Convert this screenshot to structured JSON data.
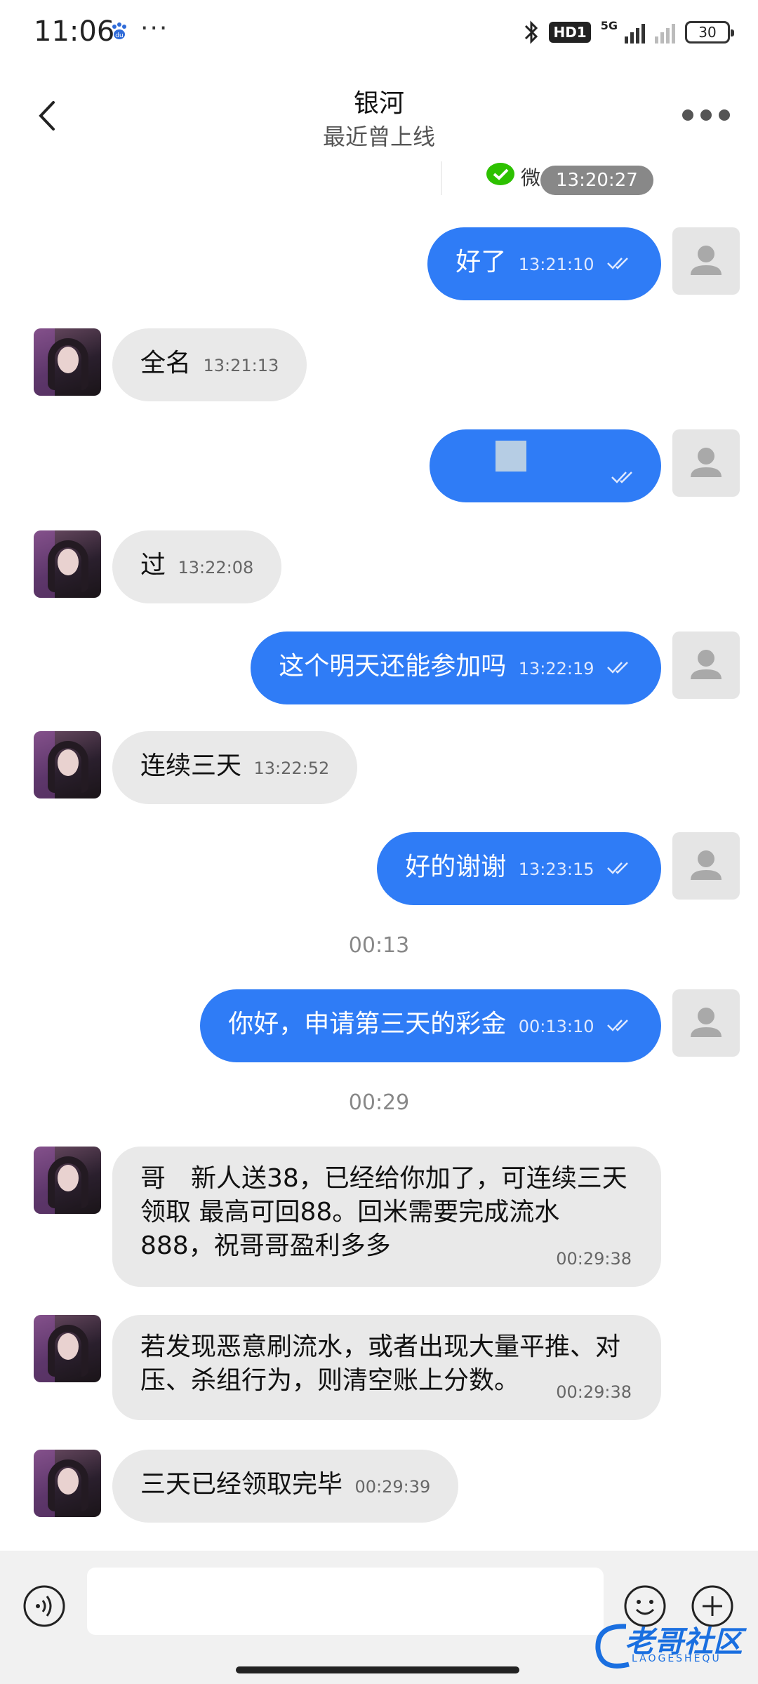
{
  "status_bar": {
    "time": "11:06",
    "more": "···",
    "hd": "HD1",
    "network": "5G",
    "battery": "30"
  },
  "header": {
    "title": "银河",
    "subtitle": "最近曾上线"
  },
  "partial_message": {
    "preview": "微",
    "time": "13:20:27"
  },
  "messages": [
    {
      "dir": "out",
      "text": "好了",
      "time": "13:21:10"
    },
    {
      "dir": "in",
      "text": "全名",
      "time": "13:21:13"
    },
    {
      "dir": "out",
      "text": "",
      "time": "",
      "redacted": true
    },
    {
      "dir": "in",
      "text": "过",
      "time": "13:22:08"
    },
    {
      "dir": "out",
      "text": "这个明天还能参加吗",
      "time": "13:22:19"
    },
    {
      "dir": "in",
      "text": "连续三天",
      "time": "13:22:52"
    },
    {
      "dir": "out",
      "text": "好的谢谢",
      "time": "13:23:15"
    },
    {
      "dir": "out",
      "text": "你好，申请第三天的彩金",
      "time": "00:13:10"
    },
    {
      "dir": "in",
      "text": "哥　新人送38，已经给你加了，可连续三天领取 最高可回88。回米需要完成流水888，祝哥哥盈利多多",
      "time": "00:29:38"
    },
    {
      "dir": "in",
      "text": "若发现恶意刷流水，或者出现大量平推、对压、杀组行为，则清空账上分数。",
      "time": "00:29:38"
    },
    {
      "dir": "in",
      "text": "三天已经领取完毕",
      "time": "00:29:39"
    }
  ],
  "day_labels": [
    "00:13",
    "00:29"
  ],
  "watermark": {
    "name": "老哥社区",
    "sub": "LAOGESHEQU"
  },
  "colors": {
    "outgoing_bubble": "#2f7cf6",
    "incoming_bubble": "#e9e9e9"
  },
  "icons": [
    "back-icon",
    "more-icon",
    "voice-icon",
    "emoji-icon",
    "plus-icon",
    "double-check-icon",
    "default-avatar-icon",
    "bluetooth-icon",
    "wechat-icon"
  ]
}
